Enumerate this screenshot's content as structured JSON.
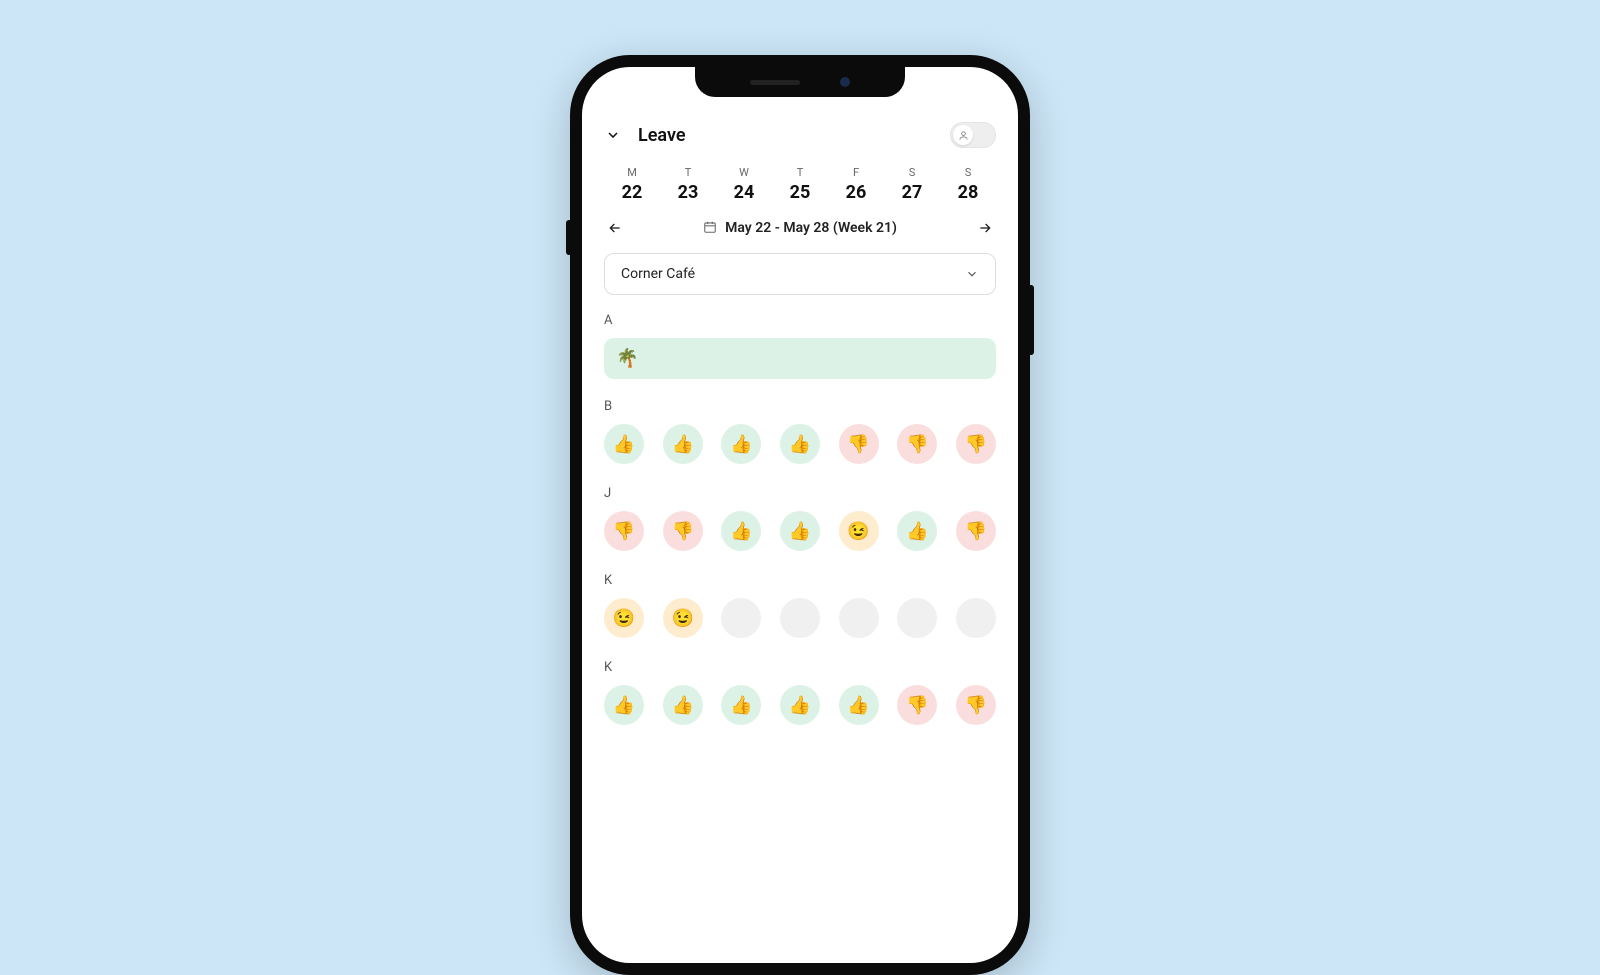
{
  "header": {
    "title": "Leave"
  },
  "days": [
    {
      "letter": "M",
      "num": "22"
    },
    {
      "letter": "T",
      "num": "23"
    },
    {
      "letter": "W",
      "num": "24"
    },
    {
      "letter": "T",
      "num": "25"
    },
    {
      "letter": "F",
      "num": "26"
    },
    {
      "letter": "S",
      "num": "27"
    },
    {
      "letter": "S",
      "num": "28"
    }
  ],
  "week_label": "May 22 - May 28 (Week 21)",
  "location": "Corner Café",
  "sections": [
    {
      "label": "A",
      "type": "vacation",
      "emoji": "🌴"
    },
    {
      "label": "B",
      "statuses": [
        "up",
        "up",
        "up",
        "up",
        "down",
        "down",
        "down"
      ]
    },
    {
      "label": "J",
      "statuses": [
        "down",
        "down",
        "up",
        "up",
        "wink",
        "up",
        "down"
      ]
    },
    {
      "label": "K",
      "statuses": [
        "wink",
        "wink",
        "empty",
        "empty",
        "empty",
        "empty",
        "empty"
      ]
    },
    {
      "label": "K",
      "statuses": [
        "up",
        "up",
        "up",
        "up",
        "up",
        "down",
        "down"
      ]
    }
  ],
  "status_emoji": {
    "up": "👍",
    "down": "👎",
    "wink": "😉",
    "empty": ""
  }
}
